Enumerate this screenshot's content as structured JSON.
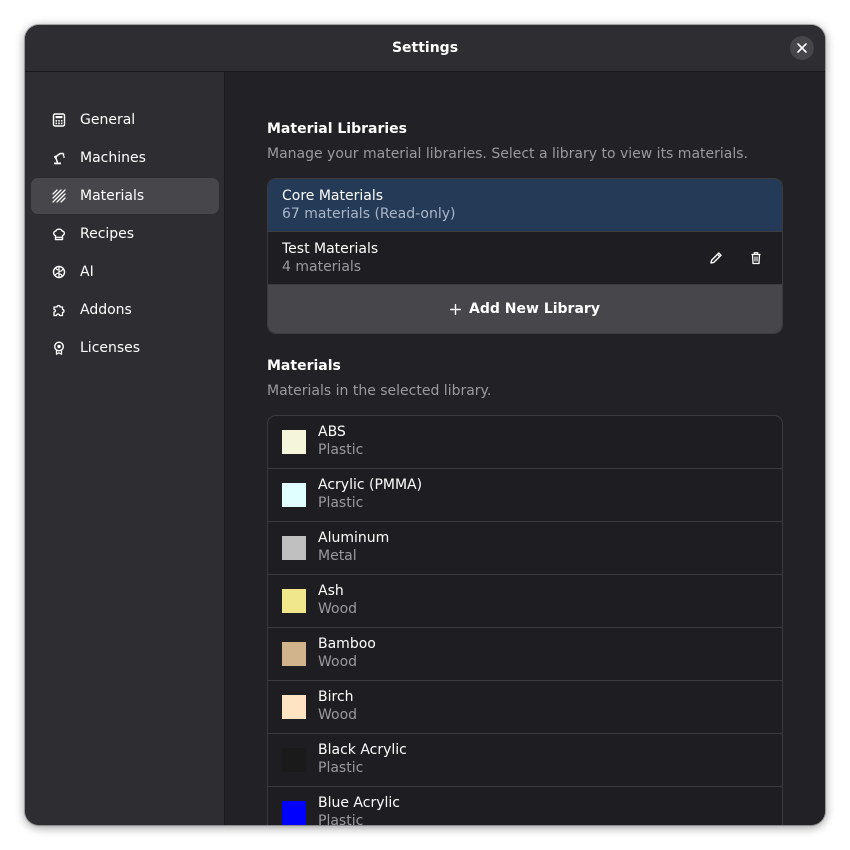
{
  "window": {
    "title": "Settings"
  },
  "sidebar": {
    "items": [
      {
        "label": "General",
        "icon": "calculator-icon"
      },
      {
        "label": "Machines",
        "icon": "machine-arm-icon"
      },
      {
        "label": "Materials",
        "icon": "hatch-pattern-icon",
        "active": true
      },
      {
        "label": "Recipes",
        "icon": "chef-hat-icon"
      },
      {
        "label": "AI",
        "icon": "brain-icon"
      },
      {
        "label": "Addons",
        "icon": "puzzle-icon"
      },
      {
        "label": "Licenses",
        "icon": "award-ribbon-icon"
      }
    ]
  },
  "libraries": {
    "title": "Material Libraries",
    "description": "Manage your material libraries. Select a library to view its materials.",
    "items": [
      {
        "name": "Core Materials",
        "detail": "67 materials (Read-only)",
        "selected": true
      },
      {
        "name": "Test Materials",
        "detail": "4 materials",
        "selected": false
      }
    ],
    "add_label": "Add New Library"
  },
  "materials": {
    "title": "Materials",
    "description": "Materials in the selected library.",
    "items": [
      {
        "name": "ABS",
        "type": "Plastic",
        "color": "#f5f5dc"
      },
      {
        "name": "Acrylic (PMMA)",
        "type": "Plastic",
        "color": "#e0ffff"
      },
      {
        "name": "Aluminum",
        "type": "Metal",
        "color": "#c0c0c0"
      },
      {
        "name": "Ash",
        "type": "Wood",
        "color": "#f0e68c"
      },
      {
        "name": "Bamboo",
        "type": "Wood",
        "color": "#d2b48c"
      },
      {
        "name": "Birch",
        "type": "Wood",
        "color": "#ffe4c4"
      },
      {
        "name": "Black Acrylic",
        "type": "Plastic",
        "color": "#1a1a1a"
      },
      {
        "name": "Blue Acrylic",
        "type": "Plastic",
        "color": "#0000ff"
      }
    ]
  },
  "colors": {
    "selected_row": "#243a57",
    "active_sidebar": "#46464b"
  }
}
